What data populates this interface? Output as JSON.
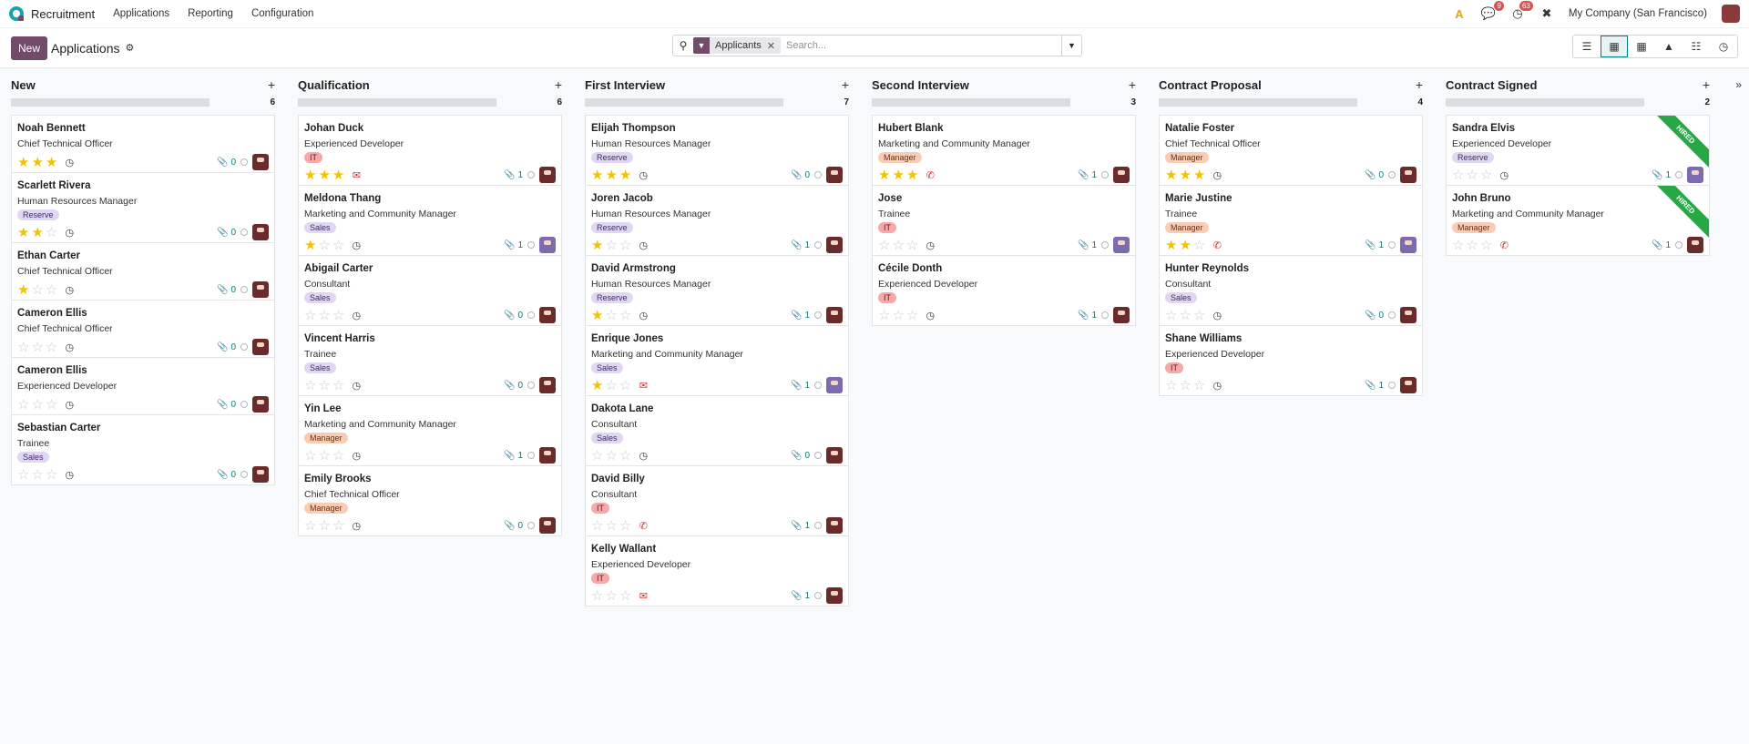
{
  "nav": {
    "app_name": "Recruitment",
    "menu": [
      "Applications",
      "Reporting",
      "Configuration"
    ],
    "badges": {
      "messages": "9",
      "activities": "63"
    },
    "company": "My Company (San Francisco)"
  },
  "control": {
    "new_label": "New",
    "title": "Applications",
    "facet_label": "Applicants",
    "search_placeholder": "Search..."
  },
  "columns": [
    {
      "title": "New",
      "count": "6",
      "cards": [
        {
          "name": "Noah Bennett",
          "job": "Chief Technical Officer",
          "tag": "",
          "stars": 3,
          "activity": "clock",
          "attachments": "0",
          "avatar": "a"
        },
        {
          "name": "Scarlett Rivera",
          "job": "Human Resources Manager",
          "tag": "Reserve",
          "stars": 2,
          "activity": "clock",
          "attachments": "0",
          "avatar": "a"
        },
        {
          "name": "Ethan Carter",
          "job": "Chief Technical Officer",
          "tag": "",
          "stars": 1,
          "activity": "clock",
          "attachments": "0",
          "avatar": "a"
        },
        {
          "name": "Cameron Ellis",
          "job": "Chief Technical Officer",
          "tag": "",
          "stars": 0,
          "activity": "clock",
          "attachments": "0",
          "avatar": "a"
        },
        {
          "name": "Cameron Ellis",
          "job": "Experienced Developer",
          "tag": "",
          "stars": 0,
          "activity": "clock",
          "attachments": "0",
          "avatar": "a"
        },
        {
          "name": "Sebastian Carter",
          "job": "Trainee",
          "tag": "Sales",
          "stars": 0,
          "activity": "clock",
          "attachments": "0",
          "avatar": "a"
        }
      ]
    },
    {
      "title": "Qualification",
      "count": "6",
      "cards": [
        {
          "name": "Johan Duck",
          "job": "Experienced Developer",
          "tag": "IT",
          "stars": 3,
          "activity": "mail",
          "attachments": "1",
          "avatar": "a"
        },
        {
          "name": "Meldona Thang",
          "job": "Marketing and Community Manager",
          "tag": "Sales",
          "stars": 1,
          "activity": "clock",
          "attachments": "1",
          "avatar": "b"
        },
        {
          "name": "Abigail Carter",
          "job": "Consultant",
          "tag": "Sales",
          "stars": 0,
          "activity": "clock",
          "attachments": "0",
          "avatar": "a"
        },
        {
          "name": "Vincent Harris",
          "job": "Trainee",
          "tag": "Sales",
          "stars": 0,
          "activity": "clock",
          "attachments": "0",
          "avatar": "a"
        },
        {
          "name": "Yin Lee",
          "job": "Marketing and Community Manager",
          "tag": "Manager",
          "stars": 0,
          "activity": "clock",
          "attachments": "1",
          "avatar": "a"
        },
        {
          "name": "Emily Brooks",
          "job": "Chief Technical Officer",
          "tag": "Manager",
          "stars": 0,
          "activity": "clock",
          "attachments": "0",
          "avatar": "a"
        }
      ]
    },
    {
      "title": "First Interview",
      "count": "7",
      "cards": [
        {
          "name": "Elijah Thompson",
          "job": "Human Resources Manager",
          "tag": "Reserve",
          "stars": 3,
          "activity": "clock",
          "attachments": "0",
          "avatar": "a"
        },
        {
          "name": "Joren Jacob",
          "job": "Human Resources Manager",
          "tag": "Reserve",
          "stars": 1,
          "activity": "clock",
          "attachments": "1",
          "avatar": "a"
        },
        {
          "name": "David Armstrong",
          "job": "Human Resources Manager",
          "tag": "Reserve",
          "stars": 1,
          "activity": "clock",
          "attachments": "1",
          "avatar": "a"
        },
        {
          "name": "Enrique Jones",
          "job": "Marketing and Community Manager",
          "tag": "Sales",
          "stars": 1,
          "activity": "mail",
          "attachments": "1",
          "avatar": "b"
        },
        {
          "name": "Dakota Lane",
          "job": "Consultant",
          "tag": "Sales",
          "stars": 0,
          "activity": "clock",
          "attachments": "0",
          "avatar": "a"
        },
        {
          "name": "David Billy",
          "job": "Consultant",
          "tag": "IT",
          "stars": 0,
          "activity": "phone",
          "attachments": "1",
          "avatar": "a"
        },
        {
          "name": "Kelly Wallant",
          "job": "Experienced Developer",
          "tag": "IT",
          "stars": 0,
          "activity": "mail",
          "attachments": "1",
          "avatar": "a"
        }
      ]
    },
    {
      "title": "Second Interview",
      "count": "3",
      "cards": [
        {
          "name": "Hubert Blank",
          "job": "Marketing and Community Manager",
          "tag": "Manager",
          "stars": 3,
          "activity": "phone",
          "attachments": "1",
          "avatar": "a"
        },
        {
          "name": "Jose",
          "job": "Trainee",
          "tag": "IT",
          "stars": 0,
          "activity": "clock",
          "attachments": "1",
          "avatar": "b"
        },
        {
          "name": "Cécile Donth",
          "job": "Experienced Developer",
          "tag": "IT",
          "stars": 0,
          "activity": "clock",
          "attachments": "1",
          "avatar": "a"
        }
      ]
    },
    {
      "title": "Contract Proposal",
      "count": "4",
      "cards": [
        {
          "name": "Natalie Foster",
          "job": "Chief Technical Officer",
          "tag": "Manager",
          "stars": 3,
          "activity": "clock",
          "attachments": "0",
          "avatar": "a"
        },
        {
          "name": "Marie Justine",
          "job": "Trainee",
          "tag": "Manager",
          "stars": 2,
          "activity": "phone",
          "attachments": "1",
          "avatar": "b"
        },
        {
          "name": "Hunter Reynolds",
          "job": "Consultant",
          "tag": "Sales",
          "stars": 0,
          "activity": "clock",
          "attachments": "0",
          "avatar": "a"
        },
        {
          "name": "Shane Williams",
          "job": "Experienced Developer",
          "tag": "IT",
          "stars": 0,
          "activity": "clock",
          "attachments": "1",
          "avatar": "a"
        }
      ]
    },
    {
      "title": "Contract Signed",
      "count": "2",
      "cards": [
        {
          "name": "Sandra Elvis",
          "job": "Experienced Developer",
          "tag": "Reserve",
          "stars": 0,
          "activity": "clock",
          "attachments": "1",
          "avatar": "b",
          "ribbon": "HIRED"
        },
        {
          "name": "John Bruno",
          "job": "Marketing and Community Manager",
          "tag": "Manager",
          "stars": 0,
          "activity": "phone",
          "attachments": "1",
          "avatar": "a",
          "ribbon": "HIRED"
        }
      ]
    }
  ]
}
